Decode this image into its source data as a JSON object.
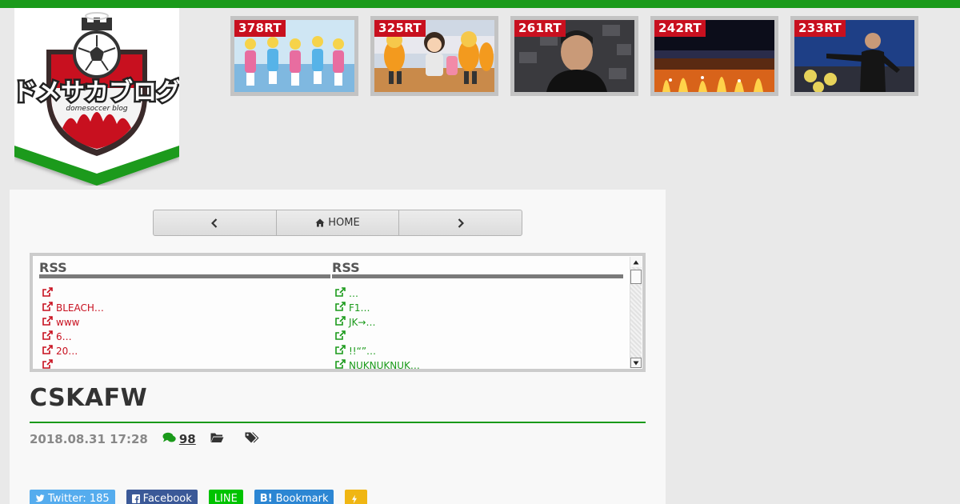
{
  "colors": {
    "accent_green": "#1a9a1a",
    "accent_red": "#c8101f",
    "twitter": "#55acee",
    "facebook": "#3b5998",
    "line": "#00c300",
    "hatena": "#2c86d3",
    "pocket": "#f0b613"
  },
  "logo": {
    "text": "ドメサカブログ",
    "subtext": "domesoccer blog"
  },
  "ranking": [
    {
      "rt": "378RT",
      "scene": "anime-idols"
    },
    {
      "rt": "325RT",
      "scene": "mascots"
    },
    {
      "rt": "261RT",
      "scene": "press-conference"
    },
    {
      "rt": "242RT",
      "scene": "stadium-flares"
    },
    {
      "rt": "233RT",
      "scene": "coach"
    }
  ],
  "nav": {
    "prev_icon": "chevron-left-icon",
    "home_icon": "home-icon",
    "home_label": "HOME",
    "next_icon": "chevron-right-icon"
  },
  "rss": {
    "left": {
      "title": "RSS",
      "items": [
        "",
        "BLEACH…",
        "www",
        "6…",
        "20…",
        ""
      ]
    },
    "right": {
      "title": "RSS",
      "items": [
        "…",
        "F1…",
        "JK→…",
        "",
        "!!“”…",
        "NUKNUKNUK…"
      ]
    }
  },
  "post": {
    "title": "CSKAFW",
    "date": "2018.08.31 17:28",
    "comment_count": "98"
  },
  "share": {
    "twitter_label": "Twitter: 185",
    "facebook_label": "Facebook",
    "line_label": "LINE",
    "hatena_b": "B!",
    "hatena_label": "Bookmark"
  }
}
